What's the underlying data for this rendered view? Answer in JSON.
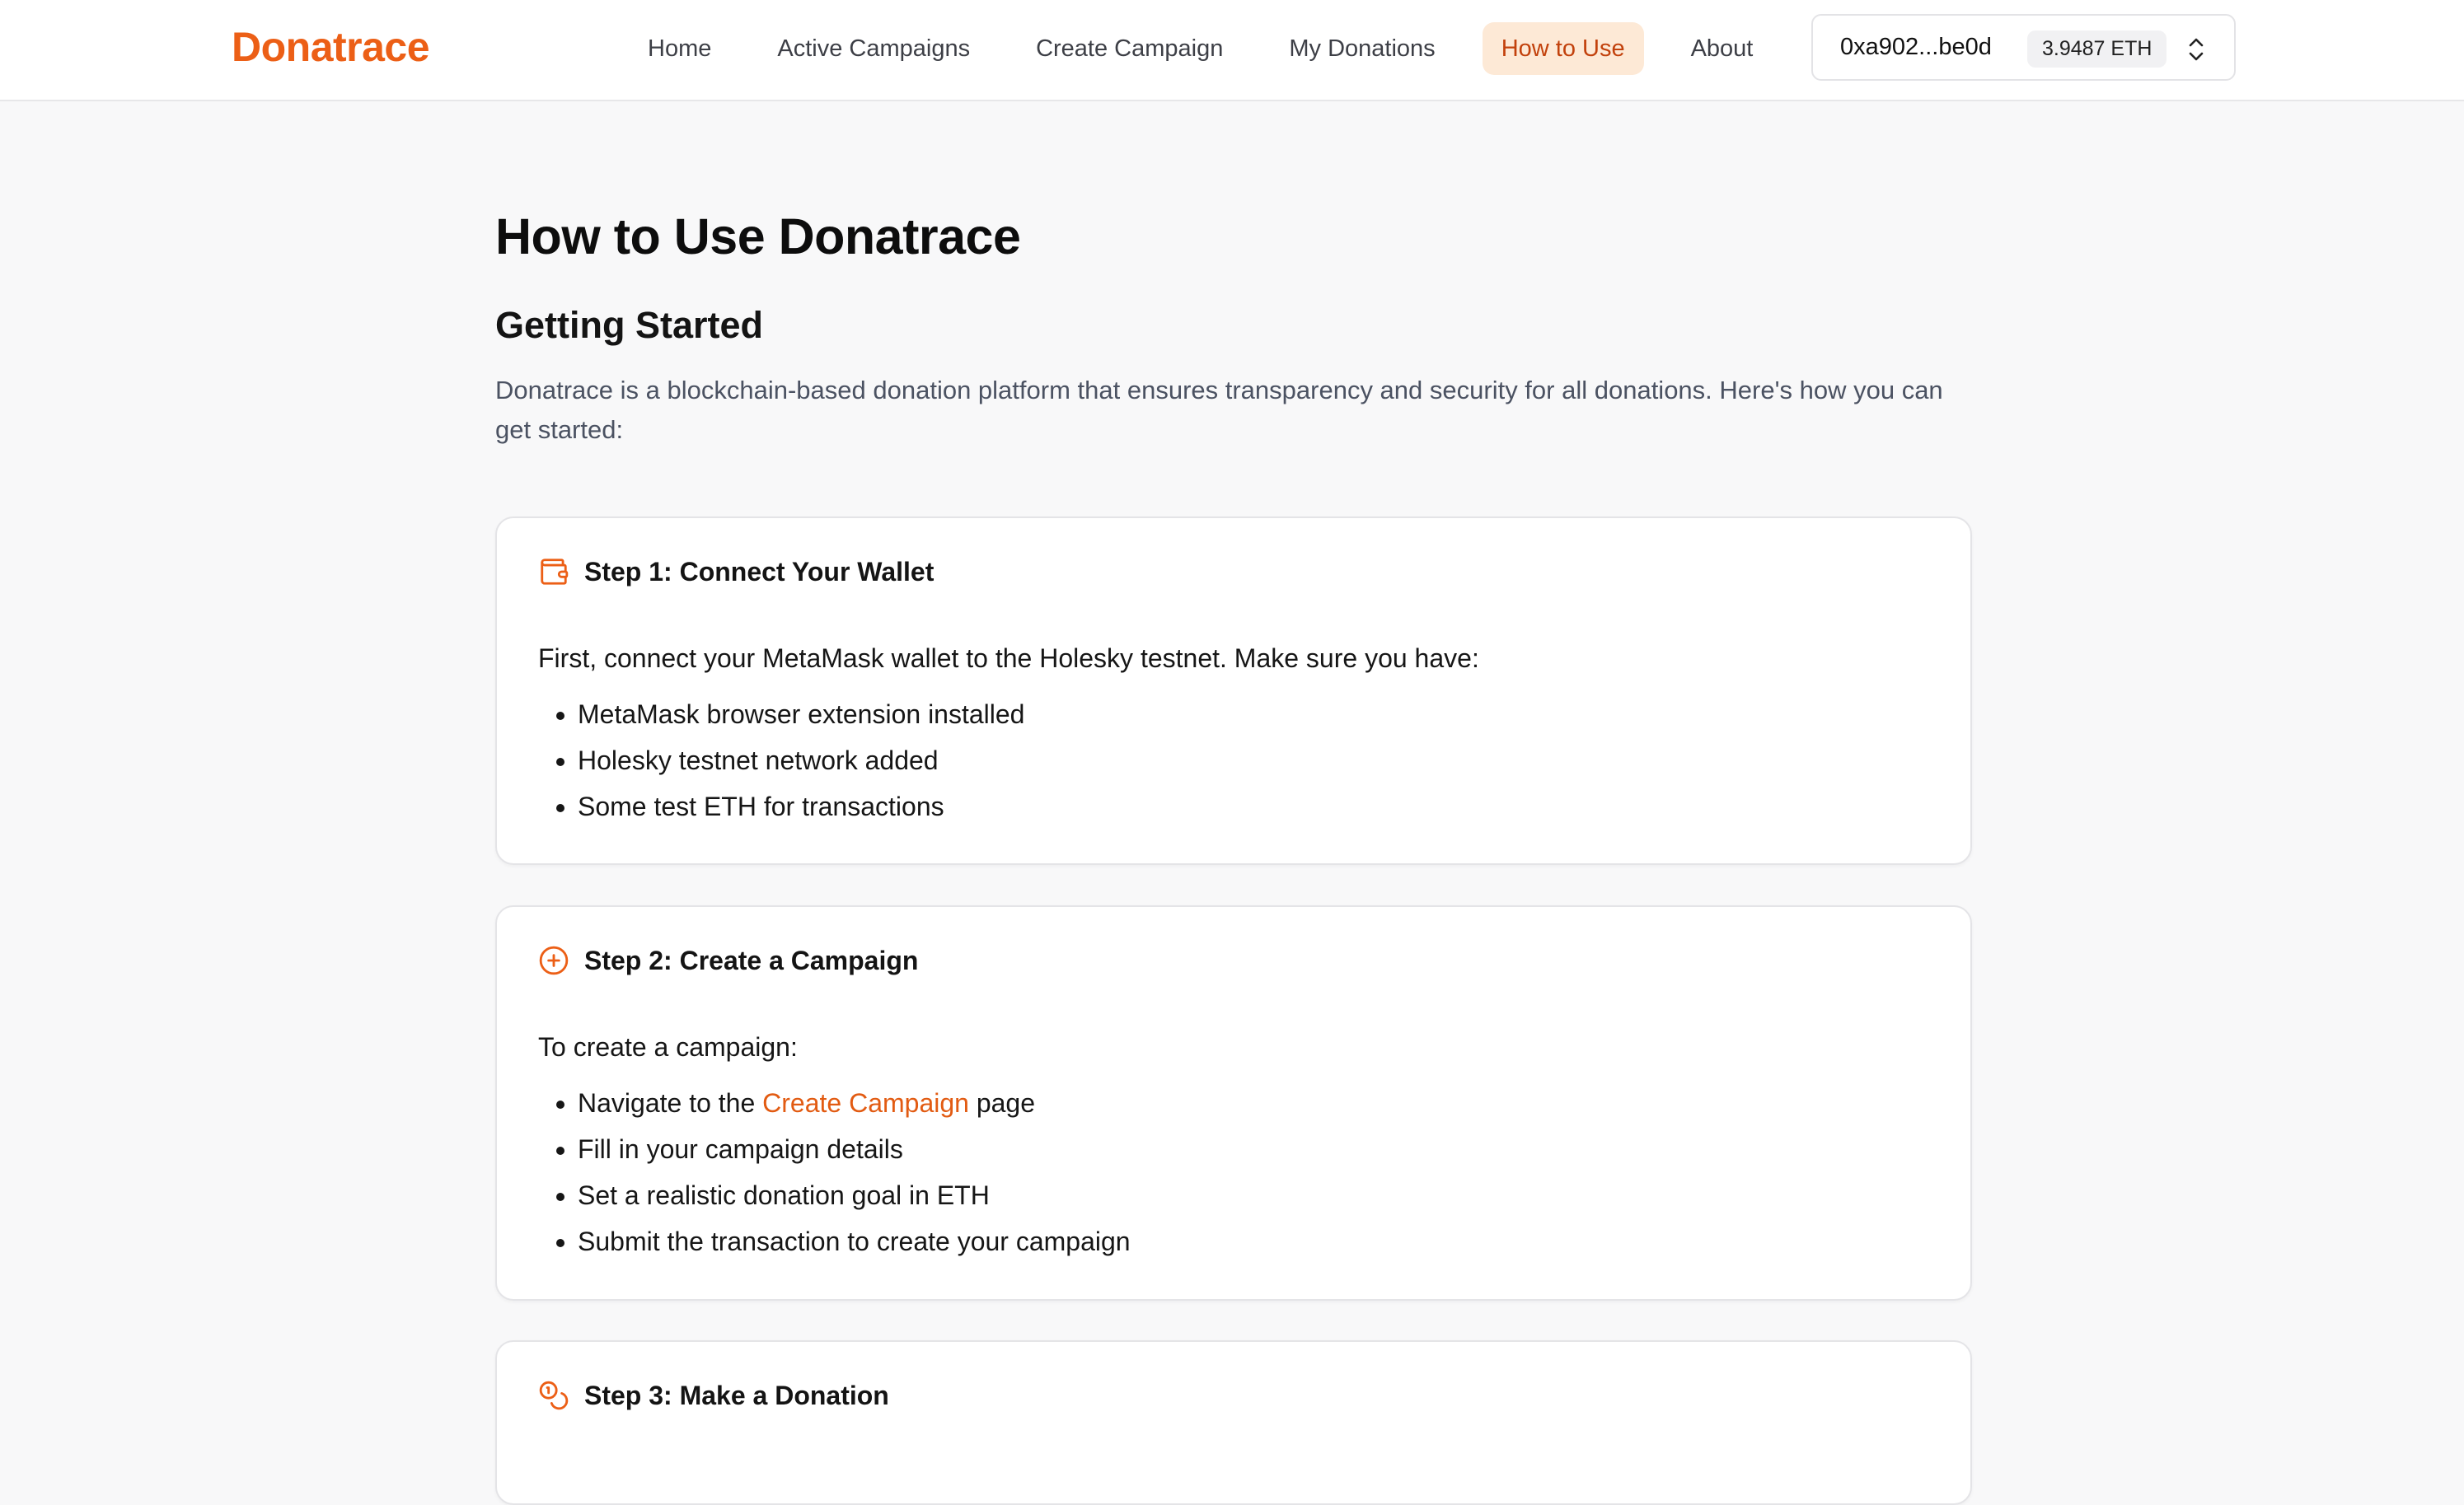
{
  "brand": "Donatrace",
  "nav": {
    "items": [
      {
        "label": "Home"
      },
      {
        "label": "Active Campaigns"
      },
      {
        "label": "Create Campaign"
      },
      {
        "label": "My Donations"
      },
      {
        "label": "How to Use",
        "active": true
      },
      {
        "label": "About"
      }
    ]
  },
  "wallet": {
    "address": "0xa902...be0d",
    "balance": "3.9487 ETH"
  },
  "page": {
    "title": "How to Use Donatrace",
    "section_title": "Getting Started",
    "intro": "Donatrace is a blockchain-based donation platform that ensures transparency and security for all donations. Here's how you can get started:"
  },
  "steps": [
    {
      "icon": "wallet-icon",
      "title": "Step 1: Connect Your Wallet",
      "lead": "First, connect your MetaMask wallet to the Holesky testnet. Make sure you have:",
      "items": [
        "MetaMask browser extension installed",
        "Holesky testnet network added",
        "Some test ETH for transactions"
      ]
    },
    {
      "icon": "plus-circle-icon",
      "title": "Step 2: Create a Campaign",
      "lead": "To create a campaign:",
      "items_first": {
        "before": "Navigate to the ",
        "link": "Create Campaign",
        "after": " page"
      },
      "items": [
        "Fill in your campaign details",
        "Set a realistic donation goal in ETH",
        "Submit the transaction to create your campaign"
      ]
    },
    {
      "icon": "coins-icon",
      "title": "Step 3: Make a Donation"
    }
  ],
  "colors": {
    "accent": "#ec5f16",
    "link": "#e25b12",
    "active_nav_bg": "#fde9d6",
    "active_nav_text": "#c2410c"
  }
}
